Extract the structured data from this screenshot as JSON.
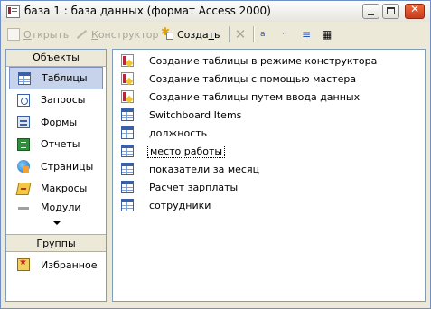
{
  "window": {
    "title": "база 1 : база данных (формат Access 2000)",
    "controls": {
      "minimize": "minimize-button",
      "maximize": "maximize-button",
      "close": "✕"
    }
  },
  "toolbar": {
    "open_label_mnemonic": "О",
    "open_label_rest": "ткрыть",
    "design_label_mnemonic": "К",
    "design_label_rest": "онструктор",
    "create_label_main": "Созда",
    "create_label_mnemonic": "т",
    "create_label_end": "ь",
    "delete_glyph": "✕",
    "large_icons_glyph": "a",
    "small_icons_glyph": "··",
    "list_glyph": "≡",
    "details_glyph": "▦"
  },
  "sidebar": {
    "objects_header": "Объекты",
    "items": [
      {
        "label": "Таблицы",
        "icon": "table-icon",
        "selected": true
      },
      {
        "label": "Запросы",
        "icon": "query-icon"
      },
      {
        "label": "Формы",
        "icon": "form-icon"
      },
      {
        "label": "Отчеты",
        "icon": "report-icon"
      },
      {
        "label": "Страницы",
        "icon": "page-icon"
      },
      {
        "label": "Макросы",
        "icon": "macro-icon"
      },
      {
        "label": "Модули",
        "icon": "module-icon"
      }
    ],
    "groups_header": "Группы",
    "groups": [
      {
        "label": "Избранное",
        "icon": "favorites-icon"
      }
    ]
  },
  "list": {
    "items": [
      {
        "label": "Создание таблицы в режиме конструктора",
        "icon": "wizard-icon"
      },
      {
        "label": "Создание таблицы с помощью мастера",
        "icon": "wizard-icon"
      },
      {
        "label": "Создание таблицы путем ввода данных",
        "icon": "wizard-icon"
      },
      {
        "label": "Switchboard Items",
        "icon": "table-icon"
      },
      {
        "label": "должность",
        "icon": "table-icon"
      },
      {
        "label": "место работы",
        "icon": "table-icon",
        "focused": true
      },
      {
        "label": "показатели за месяц",
        "icon": "table-icon"
      },
      {
        "label": "Расчет зарплаты",
        "icon": "table-icon"
      },
      {
        "label": "сотрудники",
        "icon": "table-icon"
      }
    ]
  },
  "colors": {
    "accent_selected": "#c7d3ea",
    "window_border": "#6f8fc6",
    "toolbar_bg": "#ece9d8"
  }
}
